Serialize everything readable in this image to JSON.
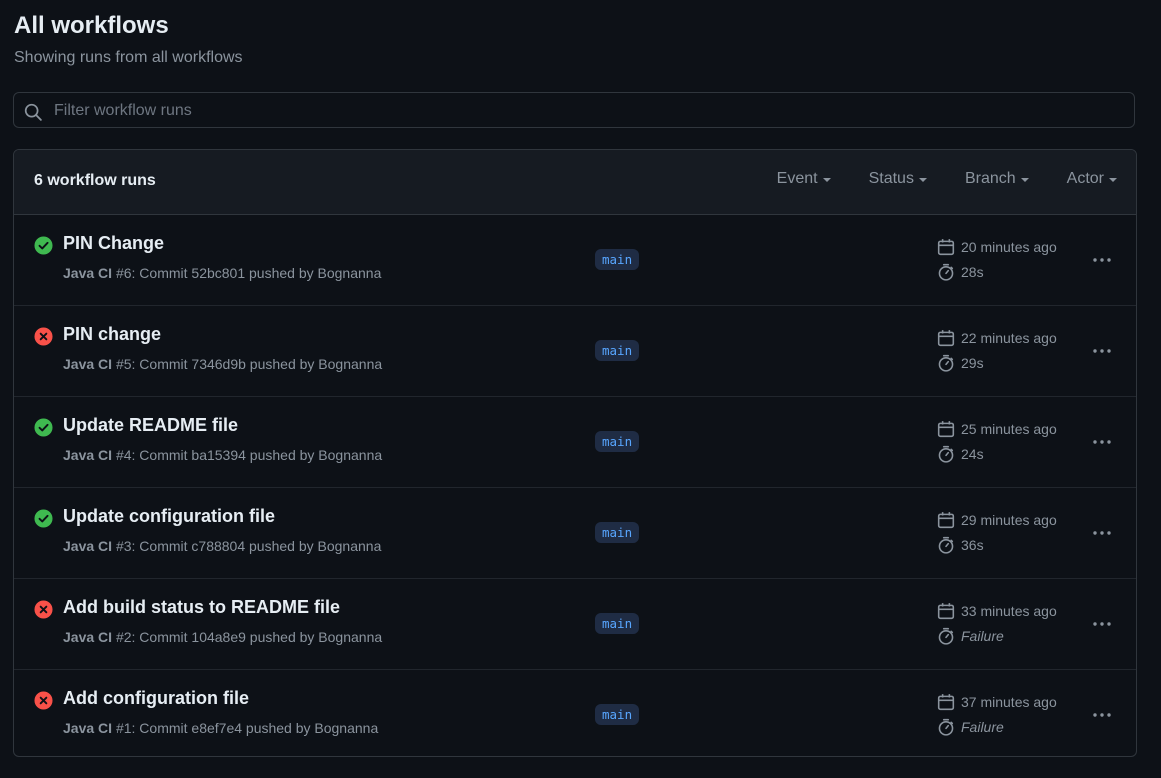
{
  "header": {
    "title": "All workflows",
    "subtitle": "Showing runs from all workflows"
  },
  "search": {
    "placeholder": "Filter workflow runs",
    "icon": "search-icon"
  },
  "list": {
    "count_label": "6 workflow runs",
    "filters": [
      "Event",
      "Status",
      "Branch",
      "Actor"
    ]
  },
  "colors": {
    "success": "#3fb950",
    "failure": "#f85149",
    "branch_text": "#58a6ff"
  },
  "runs": [
    {
      "title": "PIN Change",
      "workflow": "Java CI",
      "number": "#6",
      "details": ": Commit 52bc801 pushed by Bognanna",
      "branch": "main",
      "time": "20 minutes ago",
      "duration": "28s",
      "status": "success"
    },
    {
      "title": "PIN change",
      "workflow": "Java CI",
      "number": "#5",
      "details": ": Commit 7346d9b pushed by Bognanna",
      "branch": "main",
      "time": "22 minutes ago",
      "duration": "29s",
      "status": "failure"
    },
    {
      "title": "Update README file",
      "workflow": "Java CI",
      "number": "#4",
      "details": ": Commit ba15394 pushed by Bognanna",
      "branch": "main",
      "time": "25 minutes ago",
      "duration": "24s",
      "status": "success"
    },
    {
      "title": "Update configuration file",
      "workflow": "Java CI",
      "number": "#3",
      "details": ": Commit c788804 pushed by Bognanna",
      "branch": "main",
      "time": "29 minutes ago",
      "duration": "36s",
      "status": "success"
    },
    {
      "title": "Add build status to README file",
      "workflow": "Java CI",
      "number": "#2",
      "details": ": Commit 104a8e9 pushed by Bognanna",
      "branch": "main",
      "time": "33 minutes ago",
      "duration": "Failure",
      "status": "failure"
    },
    {
      "title": "Add configuration file",
      "workflow": "Java CI",
      "number": "#1",
      "details": ": Commit e8ef7e4 pushed by Bognanna",
      "branch": "main",
      "time": "37 minutes ago",
      "duration": "Failure",
      "status": "failure"
    }
  ]
}
